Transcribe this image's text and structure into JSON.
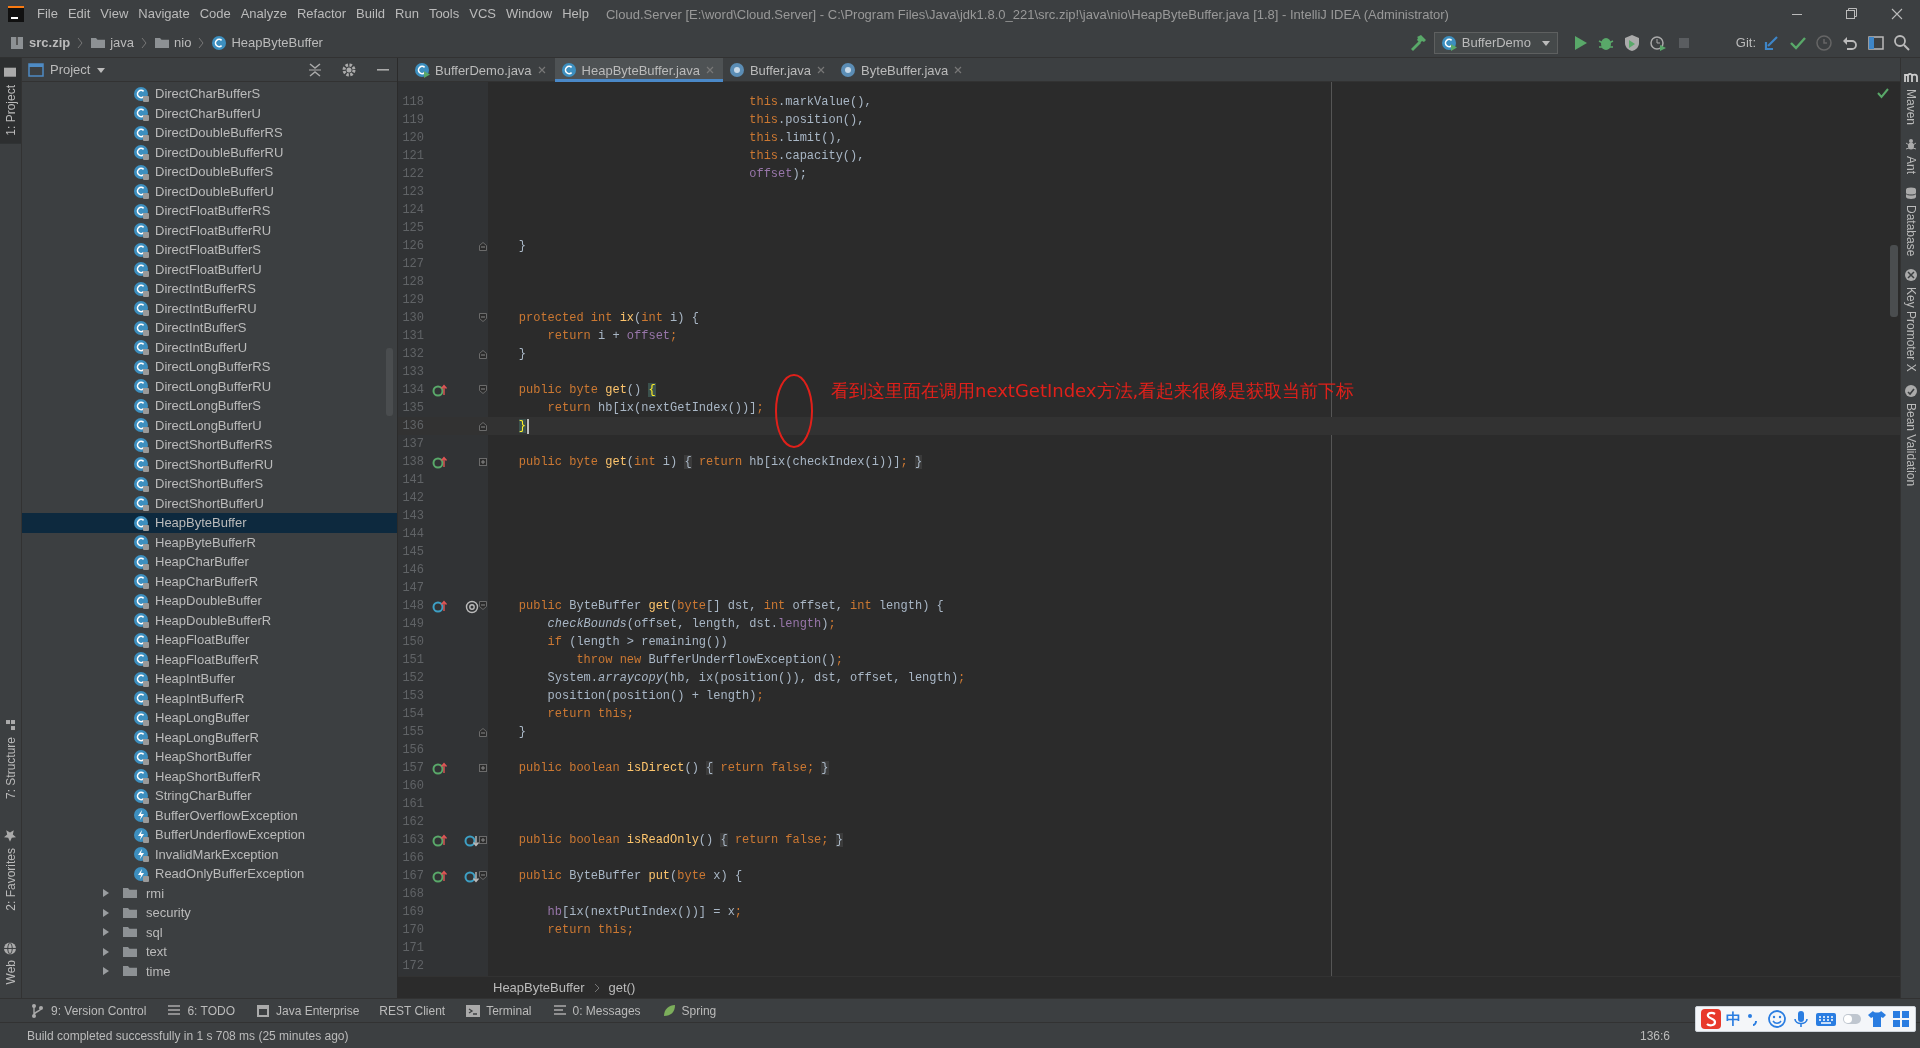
{
  "menu_bar": {
    "items": [
      "File",
      "Edit",
      "View",
      "Navigate",
      "Code",
      "Analyze",
      "Refactor",
      "Build",
      "Run",
      "Tools",
      "VCS",
      "Window",
      "Help"
    ],
    "title": "Cloud.Server [E:\\word\\Cloud.Server] - C:\\Program Files\\Java\\jdk1.8.0_221\\src.zip!\\java\\nio\\HeapByteBuffer.java [1.8] - IntelliJ IDEA (Administrator)"
  },
  "nav_bar": {
    "breadcrumbs": [
      {
        "label": "src.zip",
        "kind": "archive"
      },
      {
        "label": "java",
        "kind": "folder"
      },
      {
        "label": "nio",
        "kind": "folder"
      },
      {
        "label": "HeapByteBuffer",
        "kind": "class"
      }
    ],
    "run_config": "BufferDemo",
    "vcs_label": "Git:"
  },
  "left_stripe": [
    {
      "label": "1: Project",
      "kind": "project",
      "selected": true
    },
    {
      "label": "7: Structure",
      "kind": "structure",
      "selected": false
    },
    {
      "label": "2: Favorites",
      "kind": "favorites",
      "selected": false
    },
    {
      "label": "Web",
      "kind": "web",
      "selected": false
    }
  ],
  "project_panel": {
    "title": "Project",
    "tree": [
      {
        "label": "DirectCharBufferS",
        "kind": "class",
        "selected": false
      },
      {
        "label": "DirectCharBufferU",
        "kind": "class",
        "selected": false
      },
      {
        "label": "DirectDoubleBufferRS",
        "kind": "class",
        "selected": false
      },
      {
        "label": "DirectDoubleBufferRU",
        "kind": "class",
        "selected": false
      },
      {
        "label": "DirectDoubleBufferS",
        "kind": "class",
        "selected": false
      },
      {
        "label": "DirectDoubleBufferU",
        "kind": "class",
        "selected": false
      },
      {
        "label": "DirectFloatBufferRS",
        "kind": "class",
        "selected": false
      },
      {
        "label": "DirectFloatBufferRU",
        "kind": "class",
        "selected": false
      },
      {
        "label": "DirectFloatBufferS",
        "kind": "class",
        "selected": false
      },
      {
        "label": "DirectFloatBufferU",
        "kind": "class",
        "selected": false
      },
      {
        "label": "DirectIntBufferRS",
        "kind": "class",
        "selected": false
      },
      {
        "label": "DirectIntBufferRU",
        "kind": "class",
        "selected": false
      },
      {
        "label": "DirectIntBufferS",
        "kind": "class",
        "selected": false
      },
      {
        "label": "DirectIntBufferU",
        "kind": "class",
        "selected": false
      },
      {
        "label": "DirectLongBufferRS",
        "kind": "class",
        "selected": false
      },
      {
        "label": "DirectLongBufferRU",
        "kind": "class",
        "selected": false
      },
      {
        "label": "DirectLongBufferS",
        "kind": "class",
        "selected": false
      },
      {
        "label": "DirectLongBufferU",
        "kind": "class",
        "selected": false
      },
      {
        "label": "DirectShortBufferRS",
        "kind": "class",
        "selected": false
      },
      {
        "label": "DirectShortBufferRU",
        "kind": "class",
        "selected": false
      },
      {
        "label": "DirectShortBufferS",
        "kind": "class",
        "selected": false
      },
      {
        "label": "DirectShortBufferU",
        "kind": "class",
        "selected": false
      },
      {
        "label": "HeapByteBuffer",
        "kind": "class",
        "selected": true
      },
      {
        "label": "HeapByteBufferR",
        "kind": "class",
        "selected": false
      },
      {
        "label": "HeapCharBuffer",
        "kind": "class",
        "selected": false
      },
      {
        "label": "HeapCharBufferR",
        "kind": "class",
        "selected": false
      },
      {
        "label": "HeapDoubleBuffer",
        "kind": "class",
        "selected": false
      },
      {
        "label": "HeapDoubleBufferR",
        "kind": "class",
        "selected": false
      },
      {
        "label": "HeapFloatBuffer",
        "kind": "class",
        "selected": false
      },
      {
        "label": "HeapFloatBufferR",
        "kind": "class",
        "selected": false
      },
      {
        "label": "HeapIntBuffer",
        "kind": "class",
        "selected": false
      },
      {
        "label": "HeapIntBufferR",
        "kind": "class",
        "selected": false
      },
      {
        "label": "HeapLongBuffer",
        "kind": "class",
        "selected": false
      },
      {
        "label": "HeapLongBufferR",
        "kind": "class",
        "selected": false
      },
      {
        "label": "HeapShortBuffer",
        "kind": "class",
        "selected": false
      },
      {
        "label": "HeapShortBufferR",
        "kind": "class",
        "selected": false
      },
      {
        "label": "StringCharBuffer",
        "kind": "class",
        "selected": false
      },
      {
        "label": "BufferOverflowException",
        "kind": "exception",
        "selected": false
      },
      {
        "label": "BufferUnderflowException",
        "kind": "exception",
        "selected": false
      },
      {
        "label": "InvalidMarkException",
        "kind": "exception",
        "selected": false
      },
      {
        "label": "ReadOnlyBufferException",
        "kind": "exception",
        "selected": false
      },
      {
        "label": "rmi",
        "kind": "folder",
        "expanded": false,
        "selected": false
      },
      {
        "label": "security",
        "kind": "folder",
        "expanded": false,
        "selected": false
      },
      {
        "label": "sql",
        "kind": "folder",
        "expanded": false,
        "selected": false
      },
      {
        "label": "text",
        "kind": "folder",
        "expanded": false,
        "selected": false
      },
      {
        "label": "time",
        "kind": "folder",
        "expanded": false,
        "selected": false
      }
    ]
  },
  "editor": {
    "tabs": [
      {
        "label": "BufferDemo.java",
        "kind": "runnable",
        "selected": false
      },
      {
        "label": "HeapByteBuffer.java",
        "kind": "class",
        "selected": true
      },
      {
        "label": "Buffer.java",
        "kind": "abstract",
        "selected": false
      },
      {
        "label": "ByteBuffer.java",
        "kind": "abstract",
        "selected": false
      }
    ],
    "lines": [
      {
        "number": "118",
        "current": false,
        "code": [
          {
            "kind": "k",
            "text": "                                    this"
          },
          {
            "kind": "p",
            "text": ".markValue(),"
          }
        ]
      },
      {
        "number": "119",
        "current": false,
        "code": [
          {
            "kind": "k",
            "text": "                                    this"
          },
          {
            "kind": "p",
            "text": ".position(),"
          }
        ]
      },
      {
        "number": "120",
        "current": false,
        "code": [
          {
            "kind": "k",
            "text": "                                    this"
          },
          {
            "kind": "p",
            "text": ".limit(),"
          }
        ]
      },
      {
        "number": "121",
        "current": false,
        "code": [
          {
            "kind": "k",
            "text": "                                    this"
          },
          {
            "kind": "p",
            "text": ".capacity(),"
          }
        ]
      },
      {
        "number": "122",
        "current": false,
        "code": [
          {
            "kind": "f",
            "text": "                                    offset"
          },
          {
            "kind": "p",
            "text": ");"
          }
        ]
      },
      {
        "number": "123",
        "current": false
      },
      {
        "number": "124",
        "current": false
      },
      {
        "number": "125",
        "current": false
      },
      {
        "number": "126",
        "current": false,
        "fold": {
          "kind": "end"
        },
        "code": [
          {
            "kind": "p",
            "text": "    }"
          }
        ]
      },
      {
        "number": "127",
        "current": false
      },
      {
        "number": "128",
        "current": false
      },
      {
        "number": "129",
        "current": false
      },
      {
        "number": "130",
        "current": false,
        "fold": {
          "kind": "start"
        },
        "code": [
          {
            "kind": "k",
            "text": "    protected int "
          },
          {
            "kind": "d",
            "text": "ix"
          },
          {
            "kind": "p",
            "text": "("
          },
          {
            "kind": "k",
            "text": "int "
          },
          {
            "kind": "p",
            "text": "i) {"
          }
        ]
      },
      {
        "number": "131",
        "current": false,
        "code": [
          {
            "kind": "k",
            "text": "        return "
          },
          {
            "kind": "p",
            "text": "i + "
          },
          {
            "kind": "f",
            "text": "offset"
          },
          {
            "kind": "k",
            "text": ";"
          }
        ]
      },
      {
        "number": "132",
        "current": false,
        "fold": {
          "kind": "end"
        },
        "code": [
          {
            "kind": "p",
            "text": "    }"
          }
        ]
      },
      {
        "number": "133",
        "current": false
      },
      {
        "number": "134",
        "current": false,
        "marks": [
          {
            "kind": "implements"
          }
        ],
        "fold": {
          "kind": "start"
        },
        "code": [
          {
            "kind": "k",
            "text": "    public byte "
          },
          {
            "kind": "d",
            "text": "get"
          },
          {
            "kind": "p",
            "text": "() "
          },
          {
            "kind": "bm",
            "text": "{"
          }
        ]
      },
      {
        "number": "135",
        "current": false,
        "code": [
          {
            "kind": "k",
            "text": "        return "
          },
          {
            "kind": "p",
            "text": "hb[ix(nextGetIndex())]"
          },
          {
            "kind": "k",
            "text": ";"
          }
        ]
      },
      {
        "number": "136",
        "current": true,
        "fold": {
          "kind": "end"
        },
        "code": [
          {
            "kind": "bm",
            "text": "    }"
          }
        ]
      },
      {
        "number": "137",
        "current": false
      },
      {
        "number": "138",
        "current": false,
        "marks": [
          {
            "kind": "implements"
          }
        ],
        "fold": {
          "kind": "collapsed"
        },
        "code": [
          {
            "kind": "k",
            "text": "    public byte "
          },
          {
            "kind": "d",
            "text": "get"
          },
          {
            "kind": "p",
            "text": "("
          },
          {
            "kind": "k",
            "text": "int "
          },
          {
            "kind": "p",
            "text": "i) "
          },
          {
            "kind": "g",
            "text": "{"
          },
          {
            "kind": "k",
            "text": " return "
          },
          {
            "kind": "p",
            "text": "hb[ix(checkIndex(i))]"
          },
          {
            "kind": "k",
            "text": "; "
          },
          {
            "kind": "g",
            "text": "}"
          }
        ]
      },
      {
        "number": "141",
        "current": false
      },
      {
        "number": "142",
        "current": false
      },
      {
        "number": "143",
        "current": false
      },
      {
        "number": "144",
        "current": false
      },
      {
        "number": "145",
        "current": false
      },
      {
        "number": "146",
        "current": false
      },
      {
        "number": "147",
        "current": false
      },
      {
        "number": "148",
        "current": false,
        "marks": [
          {
            "kind": "overrides"
          },
          {
            "kind": "annotation"
          }
        ],
        "fold": {
          "kind": "start"
        },
        "code": [
          {
            "kind": "k",
            "text": "    public "
          },
          {
            "kind": "p",
            "text": "ByteBuffer "
          },
          {
            "kind": "d",
            "text": "get"
          },
          {
            "kind": "p",
            "text": "("
          },
          {
            "kind": "k",
            "text": "byte"
          },
          {
            "kind": "p",
            "text": "[] dst, "
          },
          {
            "kind": "k",
            "text": "int "
          },
          {
            "kind": "p",
            "text": "offset, "
          },
          {
            "kind": "k",
            "text": "int "
          },
          {
            "kind": "p",
            "text": "length) {"
          }
        ]
      },
      {
        "number": "149",
        "current": false,
        "code": [
          {
            "kind": "i",
            "text": "        checkBounds"
          },
          {
            "kind": "p",
            "text": "(offset, length, dst."
          },
          {
            "kind": "f",
            "text": "length"
          },
          {
            "kind": "p",
            "text": ")"
          },
          {
            "kind": "k",
            "text": ";"
          }
        ]
      },
      {
        "number": "150",
        "current": false,
        "code": [
          {
            "kind": "k",
            "text": "        if "
          },
          {
            "kind": "p",
            "text": "(length > remaining())"
          }
        ]
      },
      {
        "number": "151",
        "current": false,
        "code": [
          {
            "kind": "k",
            "text": "            throw new "
          },
          {
            "kind": "p",
            "text": "BufferUnderflowException()"
          },
          {
            "kind": "k",
            "text": ";"
          }
        ]
      },
      {
        "number": "152",
        "current": false,
        "code": [
          {
            "kind": "p",
            "text": "        System."
          },
          {
            "kind": "i",
            "text": "arraycopy"
          },
          {
            "kind": "p",
            "text": "(hb, ix(position()), dst, offset, length)"
          },
          {
            "kind": "k",
            "text": ";"
          }
        ]
      },
      {
        "number": "153",
        "current": false,
        "code": [
          {
            "kind": "p",
            "text": "        position(position() + length)"
          },
          {
            "kind": "k",
            "text": ";"
          }
        ]
      },
      {
        "number": "154",
        "current": false,
        "code": [
          {
            "kind": "k",
            "text": "        return this;"
          }
        ]
      },
      {
        "number": "155",
        "current": false,
        "fold": {
          "kind": "end"
        },
        "code": [
          {
            "kind": "p",
            "text": "    }"
          }
        ]
      },
      {
        "number": "156",
        "current": false
      },
      {
        "number": "157",
        "current": false,
        "marks": [
          {
            "kind": "implements"
          }
        ],
        "fold": {
          "kind": "collapsed"
        },
        "code": [
          {
            "kind": "k",
            "text": "    public boolean "
          },
          {
            "kind": "d",
            "text": "isDirect"
          },
          {
            "kind": "p",
            "text": "() "
          },
          {
            "kind": "g",
            "text": "{"
          },
          {
            "kind": "k",
            "text": " return false; "
          },
          {
            "kind": "g",
            "text": "}"
          }
        ]
      },
      {
        "number": "160",
        "current": false
      },
      {
        "number": "161",
        "current": false
      },
      {
        "number": "162",
        "current": false
      },
      {
        "number": "163",
        "current": false,
        "marks": [
          {
            "kind": "implements"
          },
          {
            "kind": "overridden"
          }
        ],
        "fold": {
          "kind": "collapsed"
        },
        "code": [
          {
            "kind": "k",
            "text": "    public boolean "
          },
          {
            "kind": "d",
            "text": "isReadOnly"
          },
          {
            "kind": "p",
            "text": "() "
          },
          {
            "kind": "g",
            "text": "{"
          },
          {
            "kind": "k",
            "text": " return false; "
          },
          {
            "kind": "g",
            "text": "}"
          }
        ]
      },
      {
        "number": "166",
        "current": false
      },
      {
        "number": "167",
        "current": false,
        "marks": [
          {
            "kind": "implements"
          },
          {
            "kind": "overridden"
          }
        ],
        "fold": {
          "kind": "start"
        },
        "code": [
          {
            "kind": "k",
            "text": "    public "
          },
          {
            "kind": "p",
            "text": "ByteBuffer "
          },
          {
            "kind": "d",
            "text": "put"
          },
          {
            "kind": "p",
            "text": "("
          },
          {
            "kind": "k",
            "text": "byte "
          },
          {
            "kind": "p",
            "text": "x) {"
          }
        ]
      },
      {
        "number": "168",
        "current": false
      },
      {
        "number": "169",
        "current": false,
        "code": [
          {
            "kind": "f",
            "text": "        hb"
          },
          {
            "kind": "p",
            "text": "[ix(nextPutIndex())] = x"
          },
          {
            "kind": "k",
            "text": ";"
          }
        ]
      },
      {
        "number": "170",
        "current": false,
        "code": [
          {
            "kind": "k",
            "text": "        return this;"
          }
        ]
      },
      {
        "number": "171",
        "current": false
      },
      {
        "number": "172",
        "current": false
      }
    ],
    "annotation": {
      "text": "看到这里面在调用nextGetIndex方法,看起来很像是获取当前下标"
    },
    "breadcrumbs": [
      "HeapByteBuffer",
      "get()"
    ]
  },
  "right_stripe": [
    {
      "label": "Maven",
      "kind": "maven"
    },
    {
      "label": "Ant",
      "kind": "ant"
    },
    {
      "label": "Database",
      "kind": "database"
    },
    {
      "label": "Key Promoter X",
      "kind": "keypromoter"
    },
    {
      "label": "Bean Validation",
      "kind": "bean"
    }
  ],
  "tool_bar": [
    {
      "label": "9: Version Control",
      "kind": "vcs"
    },
    {
      "label": "6: TODO",
      "kind": "todo"
    },
    {
      "label": "Java Enterprise",
      "kind": "javaee"
    },
    {
      "label": "REST Client",
      "kind": "rest"
    },
    {
      "label": "Terminal",
      "kind": "terminal"
    },
    {
      "label": "0: Messages",
      "kind": "messages"
    },
    {
      "label": "Spring",
      "kind": "spring"
    }
  ],
  "status_bar": {
    "message": "Build completed successfully in 1 s 708 ms (25 minutes ago)",
    "position": "136:6"
  },
  "ime_bar": {
    "mode": "中"
  }
}
